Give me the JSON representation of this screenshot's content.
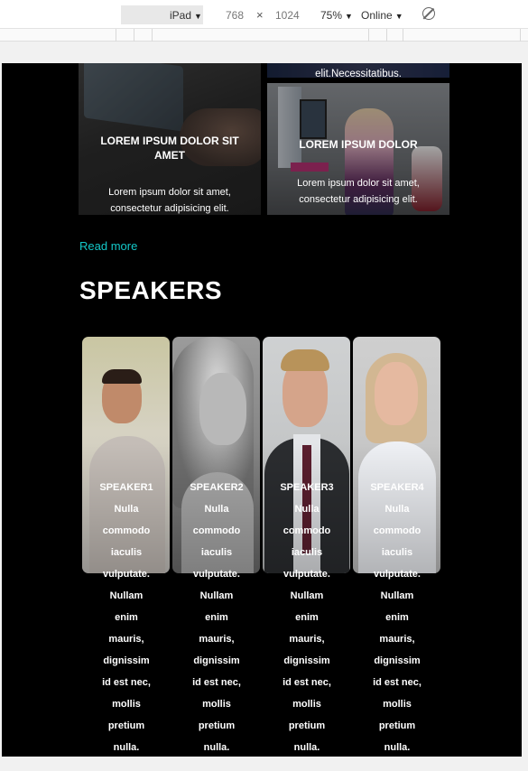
{
  "toolbar": {
    "device": "iPad",
    "width": "768",
    "times": "×",
    "height": "1024",
    "zoom": "75%",
    "network": "Online"
  },
  "cards": [
    {
      "title": "LOREM IPSUM DOLOR SIT AMET",
      "body": "Lorem ipsum dolor sit amet, consectetur adipisicing elit."
    },
    {
      "title": "LOREM IPSUM DOLOR",
      "body": "Lorem ipsum dolor sit amet, consectetur adipisicing elit."
    }
  ],
  "top_card_fragment": "elit.Necessitatibus.",
  "read_more": "Read more",
  "section_title": "SPEAKERS",
  "speakers": [
    {
      "name": "SPEAKER1",
      "description": "Nulla commodo iaculis vulputate. Nullam enim mauris, dignissim id est nec, mollis pretium nulla."
    },
    {
      "name": "SPEAKER2",
      "description": "Nulla commodo iaculis vulputate. Nullam enim mauris, dignissim id est nec, mollis pretium nulla."
    },
    {
      "name": "SPEAKER3",
      "description": "Nulla commodo iaculis vulputate. Nullam enim mauris, dignissim id est nec, mollis pretium nulla."
    },
    {
      "name": "SPEAKER4",
      "description": "Nulla commodo iaculis vulputate. Nullam enim mauris, dignissim id est nec, mollis pretium nulla."
    }
  ],
  "colors": {
    "accent": "#14c8c9",
    "background": "#000000",
    "text": "#ffffff"
  }
}
